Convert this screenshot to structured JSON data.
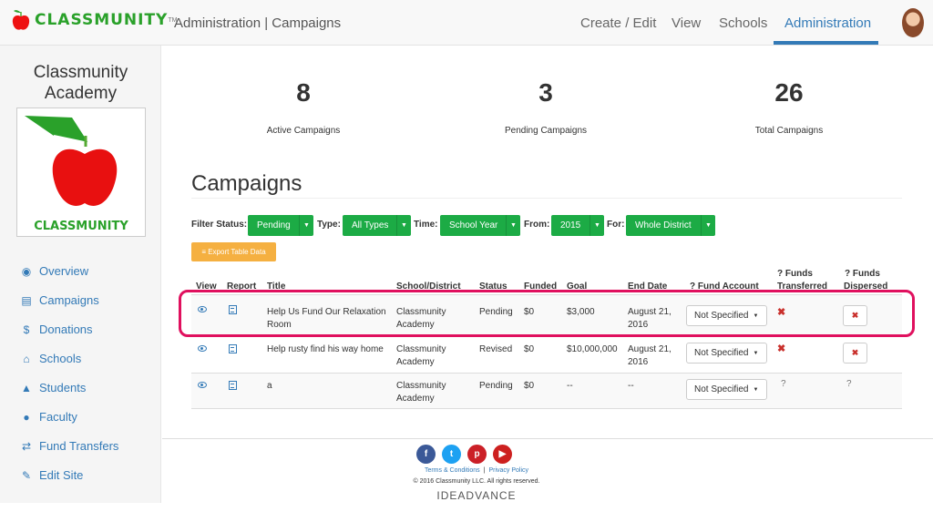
{
  "header": {
    "logo_text": "CLASSMUNITY",
    "logo_tm": "TM",
    "breadcrumb": "Administration | Campaigns",
    "nav": [
      "Create / Edit",
      "View",
      "Schools",
      "Administration"
    ]
  },
  "sidebar": {
    "school_name": "Classmunity Academy",
    "logo_text": "CLASSMUNITY",
    "items": [
      {
        "label": "Overview",
        "icon": "dashboard-icon"
      },
      {
        "label": "Campaigns",
        "icon": "newspaper-icon"
      },
      {
        "label": "Donations",
        "icon": "dollar-icon"
      },
      {
        "label": "Schools",
        "icon": "institution-icon"
      },
      {
        "label": "Students",
        "icon": "graduation-cap-icon"
      },
      {
        "label": "Faculty",
        "icon": "users-icon"
      },
      {
        "label": "Fund Transfers",
        "icon": "exchange-icon"
      },
      {
        "label": "Edit Site",
        "icon": "edit-icon"
      }
    ]
  },
  "stats": [
    {
      "value": "8",
      "label": "Active Campaigns"
    },
    {
      "value": "3",
      "label": "Pending Campaigns"
    },
    {
      "value": "26",
      "label": "Total Campaigns"
    }
  ],
  "campaigns": {
    "heading": "Campaigns",
    "filters": {
      "status_label": "Filter Status:",
      "status": "Pending",
      "type_label": "Type:",
      "type": "All Types",
      "time_label": "Time:",
      "time": "School Year",
      "from_label": "From:",
      "from": "2015",
      "for_label": "For:",
      "for": "Whole District"
    },
    "export_label": "≡ Export Table Data",
    "columns": {
      "view": "View",
      "report": "Report",
      "title": "Title",
      "school": "School/District",
      "status": "Status",
      "funded": "Funded",
      "goal": "Goal",
      "end_date": "End Date",
      "fund_account": "? Fund Account",
      "funds_transferred": [
        "? Funds",
        "Transferred"
      ],
      "funds_dispersed": [
        "? Funds",
        "Dispersed"
      ]
    },
    "rows": [
      {
        "title": "Help Us Fund Our Relaxation Room",
        "school": "Classmunity Academy",
        "status": "Pending",
        "funded": "$0",
        "goal": "$3,000",
        "end_date": "August 21, 2016",
        "fund_account": "Not Specified",
        "transferred": "x",
        "dispersed": "x"
      },
      {
        "title": "Help rusty find his way home",
        "school": "Classmunity Academy",
        "status": "Revised",
        "funded": "$0",
        "goal": "$10,000,000",
        "end_date": "August 21, 2016",
        "fund_account": "Not Specified",
        "transferred": "x",
        "dispersed": "x"
      },
      {
        "title": "a",
        "school": "Classmunity Academy",
        "status": "Pending",
        "funded": "$0",
        "goal": "--",
        "end_date": "--",
        "fund_account": "Not Specified",
        "transferred": "?",
        "dispersed": "?"
      }
    ]
  },
  "footer": {
    "social": [
      {
        "icon": "facebook-icon",
        "glyph": "f",
        "color": "#3b5998"
      },
      {
        "icon": "twitter-icon",
        "glyph": "t",
        "color": "#1da1f2"
      },
      {
        "icon": "pinterest-icon",
        "glyph": "p",
        "color": "#cb2027"
      },
      {
        "icon": "youtube-icon",
        "glyph": "▶",
        "color": "#cd201f"
      }
    ],
    "terms": "Terms & Conditions",
    "separator": "|",
    "privacy": "Privacy Policy",
    "copyright": "© 2016 Classmunity LLC. All rights reserved.",
    "brand": "IDEADVANCE"
  },
  "colors": {
    "accent": "#337ab7",
    "filter_green": "#1cab45",
    "export_orange": "#f5b041",
    "highlight": "#e0105e",
    "danger": "#c9302c"
  }
}
